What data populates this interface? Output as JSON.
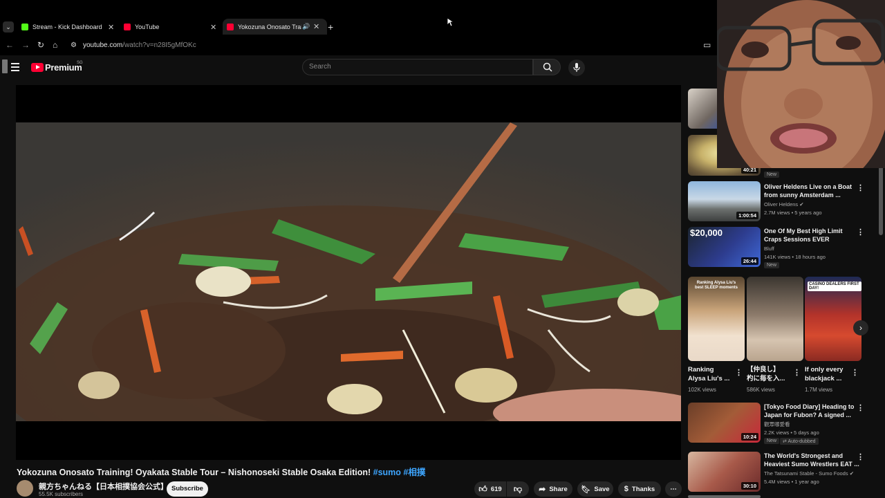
{
  "browser": {
    "tabs": [
      {
        "title": "Stream - Kick Dashboard",
        "favicon": "kick-icon",
        "color": "#53fc18"
      },
      {
        "title": "YouTube",
        "favicon": "youtube-icon",
        "color": "#ff0033"
      },
      {
        "title": "Yokozuna Onosato Training",
        "favicon": "youtube-icon",
        "color": "#ff0033",
        "active": true
      }
    ],
    "url_host": "youtube.com",
    "url_path": "/watch?v=n28I5gMfOKc"
  },
  "header": {
    "logo_text": "Premium",
    "region": "SG",
    "search_placeholder": "Search"
  },
  "video": {
    "title": "Yokozuna Onosato Training! Oyakata Stable Tour – Nishonoseki Stable Osaka Edition!",
    "hashtags": "#sumo #相撲",
    "channel": "親方ちゃんねる【日本相撲協会公式】",
    "subscribers": "55.5K subscribers",
    "subscribe_label": "Subscribe",
    "likes": "619",
    "share_label": "Share",
    "save_label": "Save",
    "thanks_label": "Thanks"
  },
  "sidebar": {
    "top_durations": [
      "40:21"
    ],
    "top_badge": "New",
    "videos": [
      {
        "title1": "Oliver Heldens Live on a Boat",
        "title2": "from sunny Amsterdam ...",
        "channel": "Oliver Heldens",
        "meta": "2.7M views • 5 years ago",
        "duration": "1:00:54",
        "verified": true,
        "badge": ""
      },
      {
        "title1": "One Of My Best High Limit",
        "title2": "Craps Sessions EVER",
        "channel": "Bluff",
        "meta": "141K views • 18 hours ago",
        "duration": "26:44",
        "verified": false,
        "badge": "New",
        "thumb_text": "$20,000"
      },
      {
        "title1": "[Tokyo Food Diary] Heading to",
        "title2": "Japan for Fubon? A signed ...",
        "channel": "觀眾哪愛看",
        "meta": "2.2K views • 5 days ago",
        "duration": "10:24",
        "verified": false,
        "badge": "New",
        "badge2": "Auto-dubbed"
      },
      {
        "title1": "The World's Strongest and",
        "title2": "Heaviest Sumo Wrestlers EAT ...",
        "channel": "The Tatsunami Stable - Sumo Foods",
        "meta": "5.4M views • 1 year ago",
        "duration": "30:10",
        "verified": true,
        "badge": ""
      }
    ],
    "shorts": [
      {
        "title1": "Ranking",
        "title2": "Alysa Liu's ...",
        "views": "102K views",
        "thumb_text": "Ranking Alysa Liu's best SLEEP moments"
      },
      {
        "title1": "【仲良し】",
        "title2": "杓に毎を入...",
        "views": "586K views",
        "thumb_text": ""
      },
      {
        "title1": "If only every",
        "title2": "blackjack ...",
        "views": "1.7M views",
        "thumb_text": "CASINO DEALERS FIRST DAY!"
      }
    ]
  },
  "colors": {
    "accent": "#3ea6ff",
    "youtube_red": "#ff0033"
  }
}
